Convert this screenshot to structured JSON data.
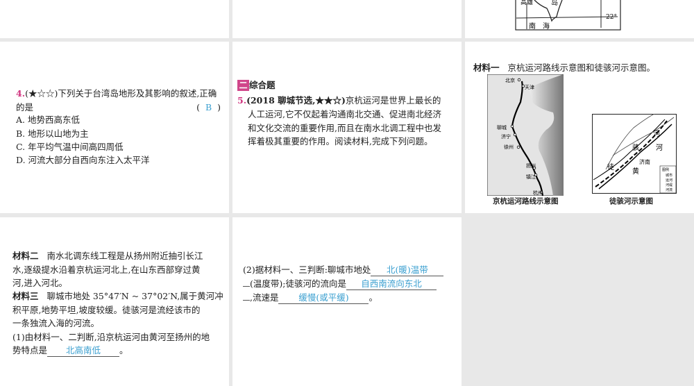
{
  "top_map": {
    "label_gaoxiong": "高雄",
    "label_dao": "岛",
    "label_lat": "22°",
    "label_nanhai": "南　海"
  },
  "q4": {
    "number": "4.",
    "stars": "(★☆☆)",
    "stem_line1": "下列关于台湾岛地形及其影响的叙述,正确",
    "stem_line2": "的是",
    "answer_open": "(",
    "answer": "B",
    "answer_close": ")",
    "options": [
      "A. 地势西高东低",
      "B. 地形以山地为主",
      "C. 年平均气温中间高四周低",
      "D. 河流大部分自西向东注入太平洋"
    ]
  },
  "section": {
    "badge": "二",
    "title": "综合题"
  },
  "q5": {
    "number": "5.",
    "source": "(2018 聊城节选,★★☆)",
    "lines": [
      "京杭运河是世界上最长的",
      "人工运河,它不仅起着沟通南北交通、促进南北经济",
      "和文化交流的重要作用,而且在南水北调工程中也发",
      "挥着极其重要的作用。阅读材料,完成下列问题。"
    ]
  },
  "material1": {
    "label": "材料一",
    "text": "京杭运河路线示意图和徒骇河示意图。",
    "map1_caption": "京杭运河路线示意图",
    "map1_cities": [
      "北京",
      "天津",
      "聊城",
      "济宁",
      "徐州",
      "扬州",
      "镇江",
      "杭州"
    ],
    "map2_caption": "徒骇河示意图",
    "map2_labels": [
      "河",
      "骇",
      "河",
      "徒",
      "黄",
      "济南"
    ],
    "legend_title": "图例",
    "legend_items": [
      "城市",
      "运河",
      "河堤",
      "河流"
    ]
  },
  "material2": {
    "label": "材料二",
    "lines": [
      "南水北调东线工程是从扬州附近抽引长江",
      "水,逐级提水沿着京杭运河北上,在山东西部穿过黄",
      "河,进入河北。"
    ]
  },
  "material3": {
    "label": "材料三",
    "lines": [
      "聊城市地处 35°47′N ~ 37°02′N,属于黄河冲",
      "积平原,地势平坦,坡度较缓。徒骇河是流经该市的",
      "一条独流入海的河流。"
    ]
  },
  "sub1": {
    "line1": "(1)由材料一、二判断,沿京杭运河由黄河至扬州的地",
    "prefix": "势特点是",
    "answer": "北高南低",
    "suffix": "。"
  },
  "sub2": {
    "prefix1": "(2)据材料一、三判断:聊城市地处",
    "answer1": "北(暖)温带",
    "prefix2": "(温度带);徒骇河的流向是",
    "answer2": "自西南流向东北",
    "prefix3": ",流速是",
    "answer3": "缓慢(或平缓)",
    "suffix": "。"
  }
}
